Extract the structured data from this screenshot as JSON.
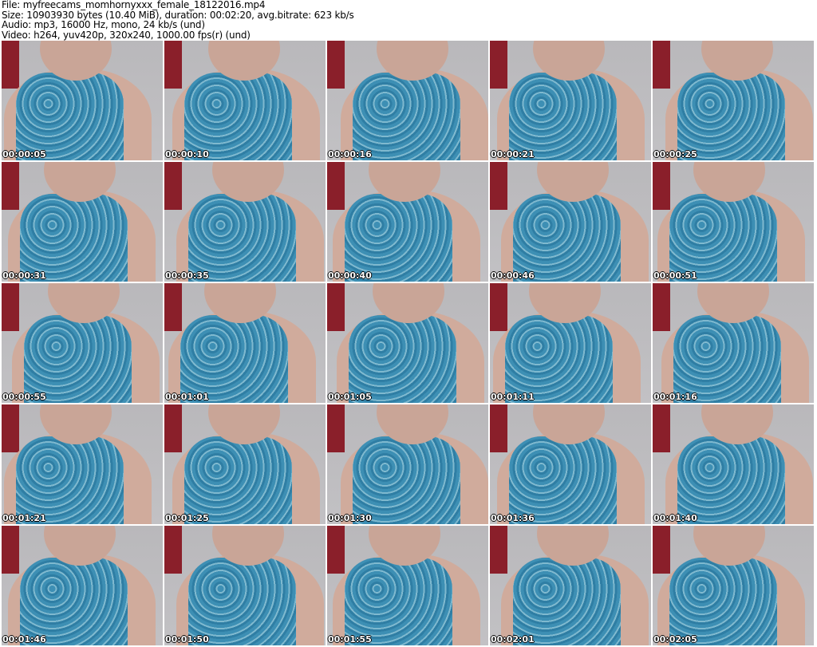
{
  "info": {
    "file": "File: myfreecams_momhornyxxx_female_18122016.mp4",
    "size": "Size: 10903930 bytes (10.40 MiB), duration: 00:02:20, avg.bitrate: 623 kb/s",
    "audio": "Audio: mp3, 16000 Hz, mono, 24 kb/s (und)",
    "video": "Video: h264, yuv420p, 320x240, 1000.00 fps(r) (und)"
  },
  "thumbnails": [
    "00:00:05",
    "00:00:10",
    "00:00:16",
    "00:00:21",
    "00:00:25",
    "00:00:31",
    "00:00:35",
    "00:00:40",
    "00:00:46",
    "00:00:51",
    "00:00:55",
    "00:01:01",
    "00:01:05",
    "00:01:11",
    "00:01:16",
    "00:01:21",
    "00:01:25",
    "00:01:30",
    "00:01:36",
    "00:01:40",
    "00:01:46",
    "00:01:50",
    "00:01:55",
    "00:02:01",
    "00:02:05"
  ]
}
